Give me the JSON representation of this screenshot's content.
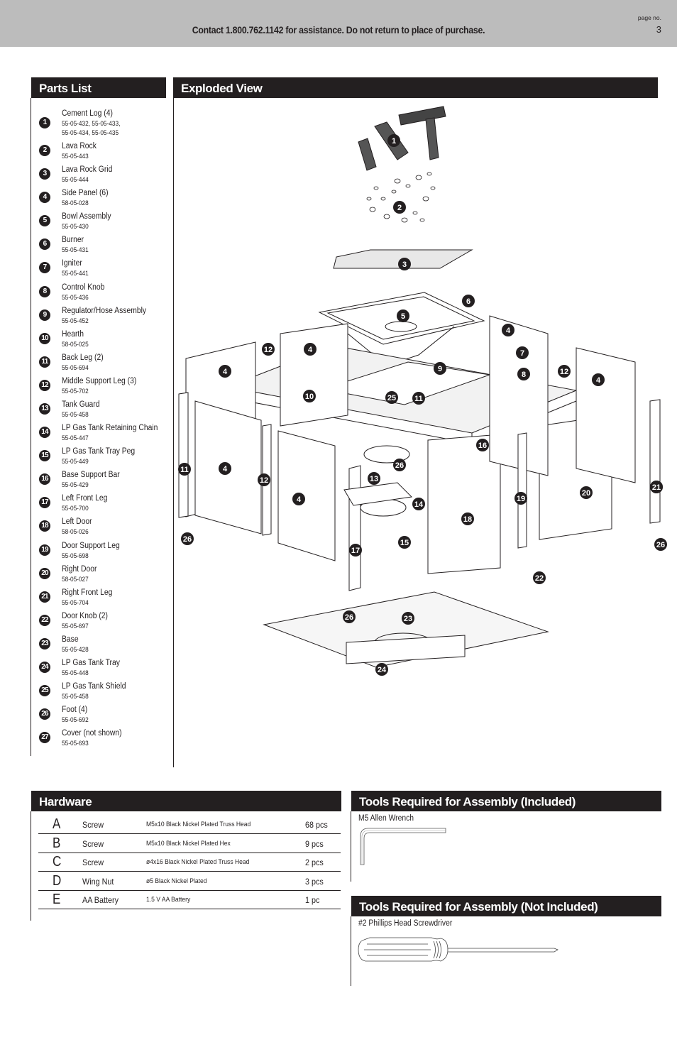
{
  "header": {
    "contact": "Contact 1.800.762.1142 for assistance. Do not return to place of purchase.",
    "page_label": "page no.",
    "page_number": "3"
  },
  "parts_list": {
    "title": "Parts List",
    "items": [
      {
        "num": "1",
        "name": "Cement Log (4)",
        "part_numbers": [
          "55-05-432, 55-05-433,",
          "55-05-434, 55-05-435"
        ]
      },
      {
        "num": "2",
        "name": "Lava Rock",
        "part_numbers": [
          "55-05-443"
        ]
      },
      {
        "num": "3",
        "name": "Lava Rock Grid",
        "part_numbers": [
          "55-05-444"
        ]
      },
      {
        "num": "4",
        "name": "Side Panel (6)",
        "part_numbers": [
          "58-05-028"
        ]
      },
      {
        "num": "5",
        "name": "Bowl Assembly",
        "part_numbers": [
          "55-05-430"
        ]
      },
      {
        "num": "6",
        "name": "Burner",
        "part_numbers": [
          "55-05-431"
        ]
      },
      {
        "num": "7",
        "name": "Igniter",
        "part_numbers": [
          "55-05-441"
        ]
      },
      {
        "num": "8",
        "name": "Control Knob",
        "part_numbers": [
          "55-05-436"
        ]
      },
      {
        "num": "9",
        "name": "Regulator/Hose Assembly",
        "part_numbers": [
          "55-05-452"
        ]
      },
      {
        "num": "10",
        "name": "Hearth",
        "part_numbers": [
          "58-05-025"
        ]
      },
      {
        "num": "11",
        "name": "Back Leg (2)",
        "part_numbers": [
          "55-05-694"
        ]
      },
      {
        "num": "12",
        "name": "Middle Support Leg (3)",
        "part_numbers": [
          "55-05-702"
        ]
      },
      {
        "num": "13",
        "name": "Tank Guard",
        "part_numbers": [
          "55-05-458"
        ]
      },
      {
        "num": "14",
        "name": "LP Gas Tank Retaining Chain",
        "part_numbers": [
          "55-05-447"
        ]
      },
      {
        "num": "15",
        "name": "LP Gas Tank Tray Peg",
        "part_numbers": [
          "55-05-449"
        ]
      },
      {
        "num": "16",
        "name": "Base Support Bar",
        "part_numbers": [
          "55-05-429"
        ]
      },
      {
        "num": "17",
        "name": "Left Front Leg",
        "part_numbers": [
          "55-05-700"
        ]
      },
      {
        "num": "18",
        "name": "Left Door",
        "part_numbers": [
          "58-05-026"
        ]
      },
      {
        "num": "19",
        "name": "Door Support Leg",
        "part_numbers": [
          "55-05-698"
        ]
      },
      {
        "num": "20",
        "name": "Right Door",
        "part_numbers": [
          "58-05-027"
        ]
      },
      {
        "num": "21",
        "name": "Right Front Leg",
        "part_numbers": [
          "55-05-704"
        ]
      },
      {
        "num": "22",
        "name": "Door Knob (2)",
        "part_numbers": [
          "55-05-697"
        ]
      },
      {
        "num": "23",
        "name": "Base",
        "part_numbers": [
          "55-05-428"
        ]
      },
      {
        "num": "24",
        "name": "LP Gas Tank Tray",
        "part_numbers": [
          "55-05-448"
        ]
      },
      {
        "num": "25",
        "name": "LP Gas Tank Shield",
        "part_numbers": [
          "55-05-458"
        ]
      },
      {
        "num": "26",
        "name": "Foot (4)",
        "part_numbers": [
          "55-05-692"
        ]
      },
      {
        "num": "27",
        "name": "Cover (not shown)",
        "part_numbers": [
          "55-05-693"
        ]
      }
    ]
  },
  "exploded_view": {
    "title": "Exploded View",
    "callouts": [
      "1",
      "2",
      "3",
      "4",
      "5",
      "6",
      "7",
      "8",
      "9",
      "10",
      "11",
      "12",
      "13",
      "14",
      "15",
      "16",
      "17",
      "18",
      "19",
      "20",
      "21",
      "22",
      "23",
      "24",
      "25",
      "26"
    ]
  },
  "hardware": {
    "title": "Hardware",
    "rows": [
      {
        "letter": "A",
        "type": "Screw",
        "description": "M5x10 Black Nickel Plated Truss Head",
        "qty": "68 pcs"
      },
      {
        "letter": "B",
        "type": "Screw",
        "description": "M5x10 Black Nickel Plated Hex",
        "qty": "9 pcs"
      },
      {
        "letter": "C",
        "type": "Screw",
        "description": "ø4x16 Black Nickel Plated Truss Head",
        "qty": "2 pcs"
      },
      {
        "letter": "D",
        "type": "Wing Nut",
        "description": "ø5 Black Nickel Plated",
        "qty": "3 pcs"
      },
      {
        "letter": "E",
        "type": "AA Battery",
        "description": "1.5 V AA Battery",
        "qty": "1 pc"
      }
    ]
  },
  "tools_included": {
    "title": "Tools Required for Assembly (Included)",
    "items": [
      "M5 Allen Wrench"
    ]
  },
  "tools_not_included": {
    "title": "Tools Required for Assembly (Not Included)",
    "items": [
      "#2 Phillips Head Screwdriver"
    ]
  }
}
